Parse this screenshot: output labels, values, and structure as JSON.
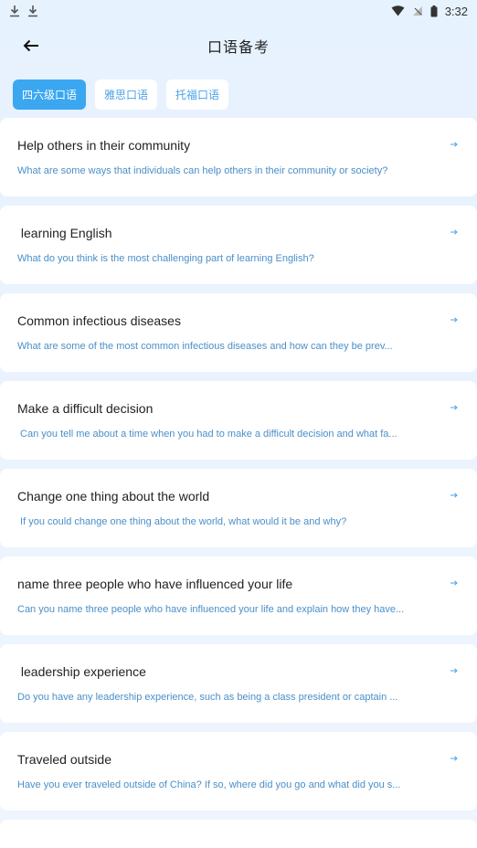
{
  "status_bar": {
    "time": "3:32"
  },
  "header": {
    "title": "口语备考"
  },
  "tabs": [
    {
      "label": "四六级口语",
      "active": true
    },
    {
      "label": "雅思口语",
      "active": false
    },
    {
      "label": "托福口语",
      "active": false
    }
  ],
  "cards": [
    {
      "title": "Help others in their community",
      "subtitle": "What are some ways that individuals can help others in their community or society?"
    },
    {
      "title": " learning English",
      "subtitle": "What do you think is the most challenging part of learning English?"
    },
    {
      "title": "Common infectious diseases",
      "subtitle": "What are some of the most common infectious diseases and how can they be prev..."
    },
    {
      "title": "Make a difficult decision",
      "subtitle": " Can you tell me about a time when you had to make a difficult decision and what fa..."
    },
    {
      "title": "Change one thing about the world",
      "subtitle": " If you could change one thing about the world, what would it be and why?"
    },
    {
      "title": "name three people who have influenced your life",
      "subtitle": "Can you name three people who have influenced your life and explain how they have..."
    },
    {
      "title": " leadership experience",
      "subtitle": "Do you have any leadership experience, such as being a class president or captain ..."
    },
    {
      "title": "Traveled outside",
      "subtitle": "Have you ever traveled outside of China? If so, where did you go and what did you s..."
    }
  ],
  "colors": {
    "accent": "#3ba7f1",
    "subtitle": "#4a8fc8"
  }
}
